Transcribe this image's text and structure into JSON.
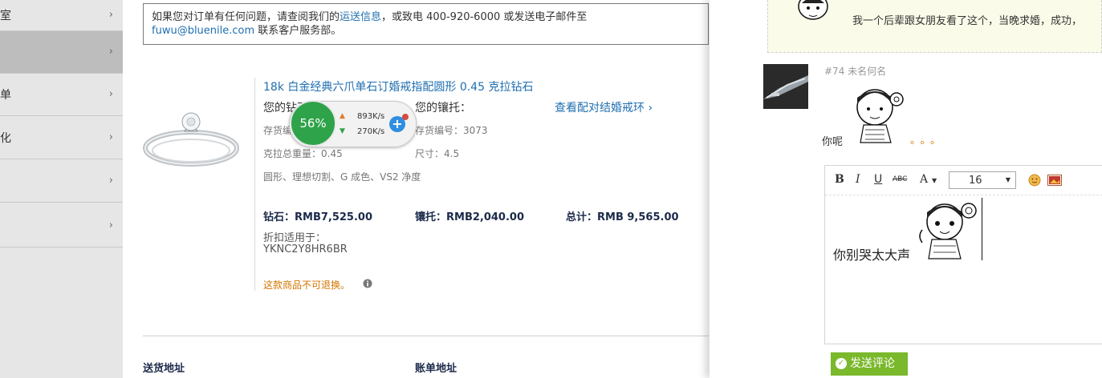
{
  "sidebar": {
    "items": [
      {
        "label": "室"
      },
      {
        "label": ""
      },
      {
        "label": "单"
      },
      {
        "label": "化"
      },
      {
        "label": ""
      },
      {
        "label": ""
      }
    ],
    "chevron": "›"
  },
  "order": {
    "notice": {
      "text1": "如果您对订单有任何问题，请查阅我们的",
      "link1": "运送信息",
      "text2": "，或致电 400-920-6000 或发送电子邮件至",
      "email": "fuwu@bluenile.com",
      "text3": " 联系客户服务部。"
    },
    "product": {
      "title": "18k 白金经典六爪单石订婚戒指配圆形 0.45 克拉钻石",
      "diamond_heading": "您的钻石：",
      "setting_heading": "您的镶托：",
      "match_link": "查看配对结婚戒环 ›",
      "diamond_stock": "存货编号：",
      "setting_stock": "存货编号：3073",
      "carat": "克拉总重量：0.45",
      "size": "尺寸：4.5",
      "specs": "圆形、理想切割、G 成色、VS2 净度",
      "diamond_price": "钻石：RMB7,525.00",
      "setting_price": "镶托：RMB2,040.00",
      "total_price": "总计：RMB 9,565.00",
      "discount_label": "折扣适用于：",
      "discount_code": "YKNC2Y8HR6BR",
      "no_exchange": "这款商品不可退换。"
    },
    "shipping_address": "送货地址",
    "billing_address": "账单地址"
  },
  "speed_widget": {
    "percent": "56%",
    "up": "893K/s",
    "down": "270K/s"
  },
  "comments": {
    "quote_text": "我一个后辈跟女朋友看了这个，当晚求婚，成功，",
    "entry_meta": "#74 未名何名",
    "entry_text": "你呢",
    "entry_dots": "。。。",
    "editor": {
      "font_size": "16",
      "content": "你别哭太大声"
    },
    "send_label": "发送评论"
  },
  "colors": {
    "sidebar_bg": "#e6e6e6",
    "sidebar_active": "#bdbdbd",
    "link": "#1f6fb0",
    "warning": "#d47500",
    "send_button": "#7ab82c",
    "speed_green": "#2fa34a"
  }
}
